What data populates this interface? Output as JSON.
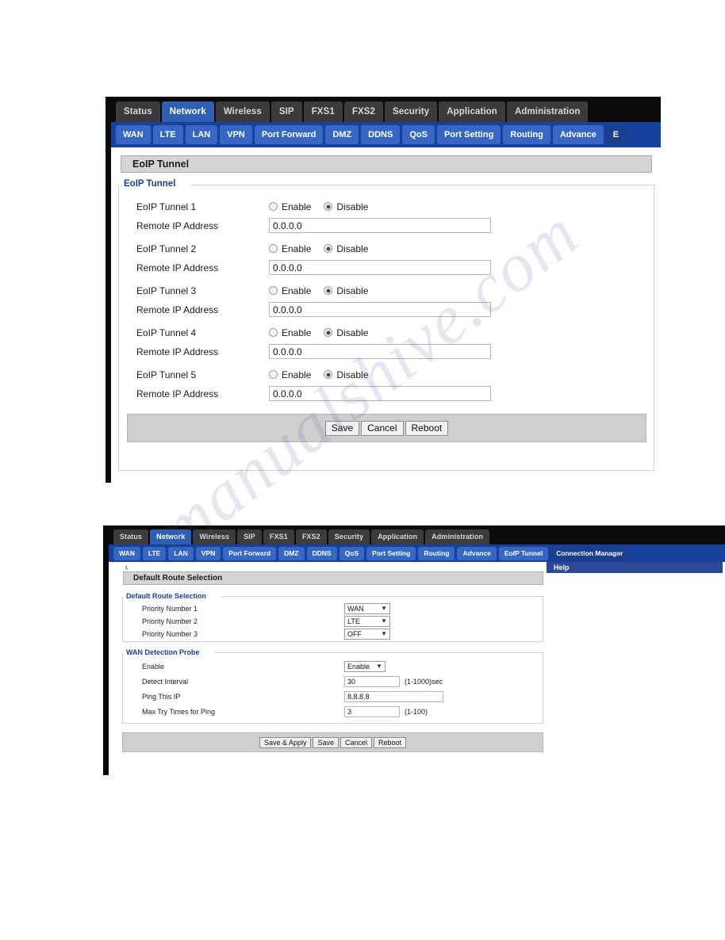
{
  "watermark": {
    "text": "manualshive.com"
  },
  "screenshot1": {
    "main_tabs": [
      {
        "label": "Status",
        "active": false
      },
      {
        "label": "Network",
        "active": true
      },
      {
        "label": "Wireless",
        "active": false
      },
      {
        "label": "SIP",
        "active": false
      },
      {
        "label": "FXS1",
        "active": false
      },
      {
        "label": "FXS2",
        "active": false
      },
      {
        "label": "Security",
        "active": false
      },
      {
        "label": "Application",
        "active": false
      },
      {
        "label": "Administration",
        "active": false
      }
    ],
    "sub_tabs": [
      {
        "label": "WAN",
        "active": false
      },
      {
        "label": "LTE",
        "active": false
      },
      {
        "label": "LAN",
        "active": false
      },
      {
        "label": "VPN",
        "active": false
      },
      {
        "label": "Port Forward",
        "active": false
      },
      {
        "label": "DMZ",
        "active": false
      },
      {
        "label": "DDNS",
        "active": false
      },
      {
        "label": "QoS",
        "active": false
      },
      {
        "label": "Port Setting",
        "active": false
      },
      {
        "label": "Routing",
        "active": false
      },
      {
        "label": "Advance",
        "active": false
      },
      {
        "label": "E",
        "active": true
      }
    ],
    "panel_title": "EoIP Tunnel",
    "legend": "EoIP Tunnel",
    "tunnels": [
      {
        "label": "EoIP Tunnel 1",
        "enable_label": "Enable",
        "disable_label": "Disable",
        "selected": "Disable",
        "ip_label": "Remote IP Address",
        "ip_value": "0.0.0.0"
      },
      {
        "label": "EoIP Tunnel 2",
        "enable_label": "Enable",
        "disable_label": "Disable",
        "selected": "Disable",
        "ip_label": "Remote IP Address",
        "ip_value": "0.0.0.0"
      },
      {
        "label": "EoIP Tunnel 3",
        "enable_label": "Enable",
        "disable_label": "Disable",
        "selected": "Disable",
        "ip_label": "Remote IP Address",
        "ip_value": "0.0.0.0"
      },
      {
        "label": "EoIP Tunnel 4",
        "enable_label": "Enable",
        "disable_label": "Disable",
        "selected": "Disable",
        "ip_label": "Remote IP Address",
        "ip_value": "0.0.0.0"
      },
      {
        "label": "EoIP Tunnel 5",
        "enable_label": "Enable",
        "disable_label": "Disable",
        "selected": "Disable",
        "ip_label": "Remote IP Address",
        "ip_value": "0.0.0.0"
      }
    ],
    "buttons": [
      {
        "label": "Save"
      },
      {
        "label": "Cancel"
      },
      {
        "label": "Reboot"
      }
    ]
  },
  "screenshot2": {
    "main_tabs": [
      {
        "label": "Status",
        "active": false
      },
      {
        "label": "Network",
        "active": true
      },
      {
        "label": "Wireless",
        "active": false
      },
      {
        "label": "SIP",
        "active": false
      },
      {
        "label": "FXS1",
        "active": false
      },
      {
        "label": "FXS2",
        "active": false
      },
      {
        "label": "Security",
        "active": false
      },
      {
        "label": "Application",
        "active": false
      },
      {
        "label": "Administration",
        "active": false
      }
    ],
    "sub_tabs": [
      {
        "label": "WAN",
        "active": false
      },
      {
        "label": "LTE",
        "active": false
      },
      {
        "label": "LAN",
        "active": false
      },
      {
        "label": "VPN",
        "active": false
      },
      {
        "label": "Port Forward",
        "active": false
      },
      {
        "label": "DMZ",
        "active": false
      },
      {
        "label": "DDNS",
        "active": false
      },
      {
        "label": "QoS",
        "active": false
      },
      {
        "label": "Port Setting",
        "active": false
      },
      {
        "label": "Routing",
        "active": false
      },
      {
        "label": "Advance",
        "active": false
      },
      {
        "label": "EoIP Tunnel",
        "active": false
      },
      {
        "label": "Connection Manager",
        "active": true
      }
    ],
    "panel_title": "Default Route Selection",
    "help_title": "Help",
    "route_section": {
      "legend": "Default Route Selection",
      "rows": [
        {
          "label": "Priority Number 1",
          "value": "WAN"
        },
        {
          "label": "Priority Number 2",
          "value": "LTE"
        },
        {
          "label": "Priority Number 3",
          "value": "OFF"
        }
      ]
    },
    "probe_section": {
      "legend": "WAN Detection Probe",
      "enable": {
        "label": "Enable",
        "value": "Enable"
      },
      "detect_interval": {
        "label": "Detect Interval",
        "value": "30",
        "hint": "(1-1000)sec"
      },
      "ping_ip": {
        "label": "Ping This IP",
        "value": "8.8.8.8",
        "hint": ""
      },
      "max_try": {
        "label": "Max Try Times for Ping",
        "value": "3",
        "hint": "(1-100)"
      }
    },
    "buttons": [
      {
        "label": "Save & Apply"
      },
      {
        "label": "Save"
      },
      {
        "label": "Cancel"
      },
      {
        "label": "Reboot"
      }
    ]
  }
}
